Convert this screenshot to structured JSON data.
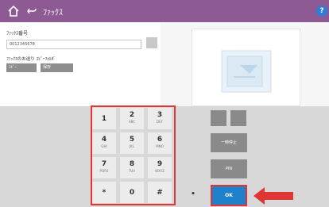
{
  "header": {
    "title": "ﾌｧｯｸｽ",
    "help_label": "?"
  },
  "form": {
    "fax_number_label": "ﾌｧｯｸｽ番号",
    "fax_number_value": "0012345678",
    "select_label": "ﾌｧｯｸｽのお送り ｺﾋﾟｰﾌｫﾙﾀﾞ",
    "toggle_1": "ｺﾋﾟｰ",
    "toggle_2": "保存"
  },
  "keypad": {
    "keys": [
      {
        "num": "1",
        "sub": ""
      },
      {
        "num": "2",
        "sub": "ABC"
      },
      {
        "num": "3",
        "sub": "DEF"
      },
      {
        "num": "4",
        "sub": "GHI"
      },
      {
        "num": "5",
        "sub": "JKL"
      },
      {
        "num": "6",
        "sub": "MNO"
      },
      {
        "num": "7",
        "sub": "PQRS"
      },
      {
        "num": "8",
        "sub": "TUV"
      },
      {
        "num": "9",
        "sub": "WXYZ"
      },
      {
        "num": "*",
        "sub": ""
      },
      {
        "num": "0",
        "sub": ""
      },
      {
        "num": "#",
        "sub": ""
      }
    ],
    "dot": "•"
  },
  "side": {
    "pause_label": "一時停止",
    "pin_label": "PIN",
    "ok_label": "OK"
  },
  "colors": {
    "topbar": "#8e5a93",
    "ok": "#1f80cc",
    "highlight": "#e03535"
  }
}
